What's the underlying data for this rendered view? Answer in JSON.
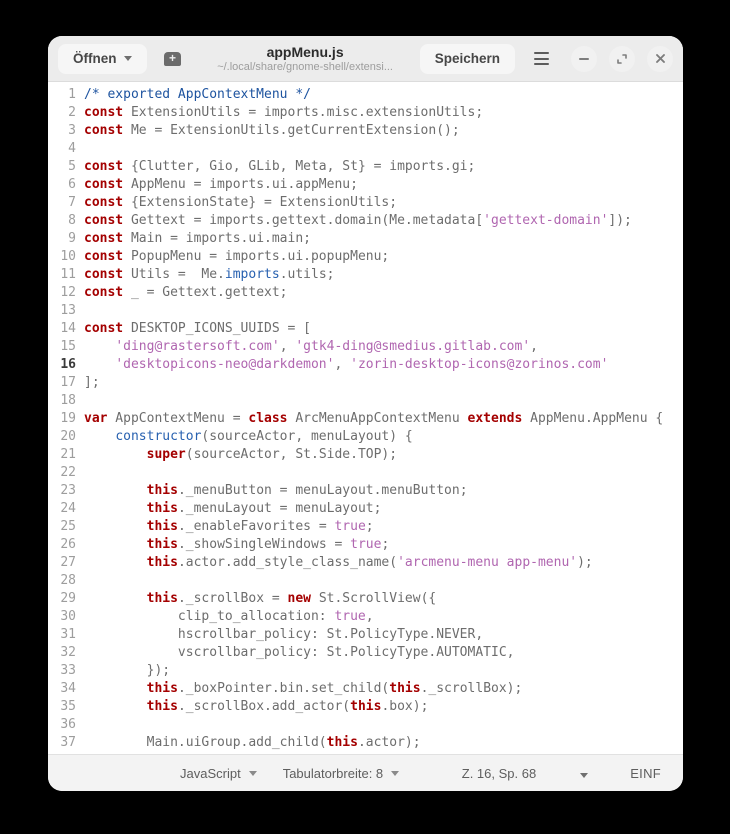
{
  "header": {
    "open_label": "Öffnen",
    "title": "appMenu.js",
    "subtitle": "~/.local/share/gnome-shell/extensi...",
    "save_label": "Speichern"
  },
  "statusbar": {
    "language": "JavaScript",
    "tab_width": "Tabulatorbreite: 8",
    "position": "Z. 16, Sp. 68",
    "insert_mode": "EINF"
  },
  "colors": {
    "kw": "#a40000",
    "cm": "#1d539f",
    "bi": "#2861b0",
    "st": "#b066b0",
    "pl": "#6d6d6d"
  },
  "editor": {
    "current_line": 16,
    "lines": [
      {
        "n": 1,
        "seg": [
          [
            "c",
            "/* exported AppContextMenu */"
          ]
        ]
      },
      {
        "n": 2,
        "seg": [
          [
            "k",
            "const"
          ],
          [
            "p",
            " ExtensionUtils = imports.misc.extensionUtils;"
          ]
        ]
      },
      {
        "n": 3,
        "seg": [
          [
            "k",
            "const"
          ],
          [
            "p",
            " Me = ExtensionUtils.getCurrentExtension();"
          ]
        ]
      },
      {
        "n": 4,
        "seg": []
      },
      {
        "n": 5,
        "seg": [
          [
            "k",
            "const"
          ],
          [
            "p",
            " {Clutter, Gio, GLib, Meta, St} = imports.gi;"
          ]
        ]
      },
      {
        "n": 6,
        "seg": [
          [
            "k",
            "const"
          ],
          [
            "p",
            " AppMenu = imports.ui.appMenu;"
          ]
        ]
      },
      {
        "n": 7,
        "seg": [
          [
            "k",
            "const"
          ],
          [
            "p",
            " {ExtensionState} = ExtensionUtils;"
          ]
        ]
      },
      {
        "n": 8,
        "seg": [
          [
            "k",
            "const"
          ],
          [
            "p",
            " Gettext = imports.gettext.domain(Me.metadata["
          ],
          [
            "s",
            "'gettext-domain'"
          ],
          [
            "p",
            "]);"
          ]
        ]
      },
      {
        "n": 9,
        "seg": [
          [
            "k",
            "const"
          ],
          [
            "p",
            " Main = imports.ui.main;"
          ]
        ]
      },
      {
        "n": 10,
        "seg": [
          [
            "k",
            "const"
          ],
          [
            "p",
            " PopupMenu = imports.ui.popupMenu;"
          ]
        ]
      },
      {
        "n": 11,
        "seg": [
          [
            "k",
            "const"
          ],
          [
            "p",
            " Utils =  Me."
          ],
          [
            "b",
            "imports"
          ],
          [
            "p",
            ".utils;"
          ]
        ]
      },
      {
        "n": 12,
        "seg": [
          [
            "k",
            "const"
          ],
          [
            "p",
            " _ = Gettext.gettext;"
          ]
        ]
      },
      {
        "n": 13,
        "seg": []
      },
      {
        "n": 14,
        "seg": [
          [
            "k",
            "const"
          ],
          [
            "p",
            " DESKTOP_ICONS_UUIDS = ["
          ]
        ]
      },
      {
        "n": 15,
        "seg": [
          [
            "p",
            "    "
          ],
          [
            "s",
            "'ding@rastersoft.com'"
          ],
          [
            "p",
            ", "
          ],
          [
            "s",
            "'gtk4-ding@smedius.gitlab.com'"
          ],
          [
            "p",
            ","
          ]
        ]
      },
      {
        "n": 16,
        "seg": [
          [
            "p",
            "    "
          ],
          [
            "s",
            "'desktopicons-neo@darkdemon'"
          ],
          [
            "p",
            ", "
          ],
          [
            "s",
            "'zorin-desktop-icons@zorinos.com'"
          ]
        ]
      },
      {
        "n": 17,
        "seg": [
          [
            "p",
            "];"
          ]
        ]
      },
      {
        "n": 18,
        "seg": []
      },
      {
        "n": 19,
        "seg": [
          [
            "k",
            "var"
          ],
          [
            "p",
            " AppContextMenu = "
          ],
          [
            "k",
            "class"
          ],
          [
            "p",
            " ArcMenuAppContextMenu "
          ],
          [
            "k",
            "extends"
          ],
          [
            "p",
            " AppMenu.AppMenu {"
          ]
        ]
      },
      {
        "n": 20,
        "seg": [
          [
            "p",
            "    "
          ],
          [
            "b",
            "constructor"
          ],
          [
            "p",
            "(sourceActor, menuLayout) {"
          ]
        ]
      },
      {
        "n": 21,
        "seg": [
          [
            "p",
            "        "
          ],
          [
            "k",
            "super"
          ],
          [
            "p",
            "(sourceActor, St.Side.TOP);"
          ]
        ]
      },
      {
        "n": 22,
        "seg": []
      },
      {
        "n": 23,
        "seg": [
          [
            "p",
            "        "
          ],
          [
            "k",
            "this"
          ],
          [
            "p",
            "._menuButton = menuLayout.menuButton;"
          ]
        ]
      },
      {
        "n": 24,
        "seg": [
          [
            "p",
            "        "
          ],
          [
            "k",
            "this"
          ],
          [
            "p",
            "._menuLayout = menuLayout;"
          ]
        ]
      },
      {
        "n": 25,
        "seg": [
          [
            "p",
            "        "
          ],
          [
            "k",
            "this"
          ],
          [
            "p",
            "._enableFavorites = "
          ],
          [
            "v",
            "true"
          ],
          [
            "p",
            ";"
          ]
        ]
      },
      {
        "n": 26,
        "seg": [
          [
            "p",
            "        "
          ],
          [
            "k",
            "this"
          ],
          [
            "p",
            "._showSingleWindows = "
          ],
          [
            "v",
            "true"
          ],
          [
            "p",
            ";"
          ]
        ]
      },
      {
        "n": 27,
        "seg": [
          [
            "p",
            "        "
          ],
          [
            "k",
            "this"
          ],
          [
            "p",
            ".actor.add_style_class_name("
          ],
          [
            "s",
            "'arcmenu-menu app-menu'"
          ],
          [
            "p",
            ");"
          ]
        ]
      },
      {
        "n": 28,
        "seg": []
      },
      {
        "n": 29,
        "seg": [
          [
            "p",
            "        "
          ],
          [
            "k",
            "this"
          ],
          [
            "p",
            "._scrollBox = "
          ],
          [
            "k",
            "new"
          ],
          [
            "p",
            " St.ScrollView({"
          ]
        ]
      },
      {
        "n": 30,
        "seg": [
          [
            "p",
            "            clip_to_allocation: "
          ],
          [
            "v",
            "true"
          ],
          [
            "p",
            ","
          ]
        ]
      },
      {
        "n": 31,
        "seg": [
          [
            "p",
            "            hscrollbar_policy: St.PolicyType.NEVER,"
          ]
        ]
      },
      {
        "n": 32,
        "seg": [
          [
            "p",
            "            vscrollbar_policy: St.PolicyType.AUTOMATIC,"
          ]
        ]
      },
      {
        "n": 33,
        "seg": [
          [
            "p",
            "        });"
          ]
        ]
      },
      {
        "n": 34,
        "seg": [
          [
            "p",
            "        "
          ],
          [
            "k",
            "this"
          ],
          [
            "p",
            "._boxPointer.bin.set_child("
          ],
          [
            "k",
            "this"
          ],
          [
            "p",
            "._scrollBox);"
          ]
        ]
      },
      {
        "n": 35,
        "seg": [
          [
            "p",
            "        "
          ],
          [
            "k",
            "this"
          ],
          [
            "p",
            "._scrollBox.add_actor("
          ],
          [
            "k",
            "this"
          ],
          [
            "p",
            ".box);"
          ]
        ]
      },
      {
        "n": 36,
        "seg": []
      },
      {
        "n": 37,
        "seg": [
          [
            "p",
            "        Main.uiGroup.add_child("
          ],
          [
            "k",
            "this"
          ],
          [
            "p",
            ".actor);"
          ]
        ]
      }
    ]
  }
}
